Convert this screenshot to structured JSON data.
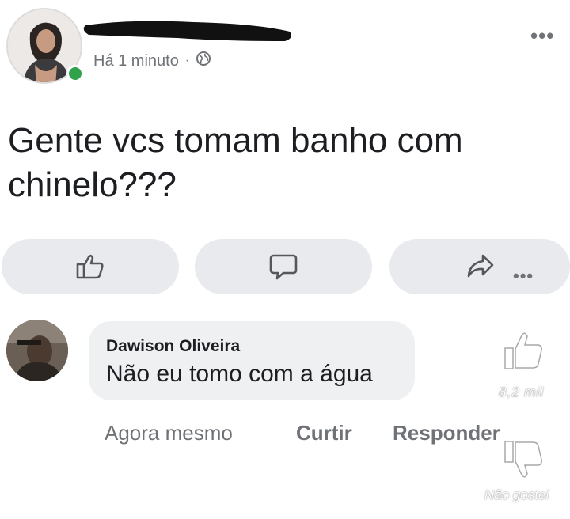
{
  "post": {
    "timestamp": "Há 1 minuto",
    "separator": "·",
    "audience_icon": "globe-icon",
    "more_icon": "more-horizontal-icon",
    "more_label": "•••",
    "text": "Gente vcs tomam banho com chinelo???"
  },
  "actions": {
    "like_icon": "thumbs-up-icon",
    "comment_icon": "comment-bubble-icon",
    "share_icon": "share-arrow-icon",
    "more_label": "•••"
  },
  "comment": {
    "author": "Dawison Oliveira",
    "text": "Não eu tomo com a água",
    "time": "Agora mesmo",
    "like_label": "Curtir",
    "reply_label": "Responder"
  },
  "overlay": {
    "like_icon": "thumbs-up-icon",
    "like_count": "8,2 mil",
    "dislike_icon": "thumbs-down-icon",
    "dislike_label": "Não gostei"
  },
  "colors": {
    "online": "#31a24c",
    "pill_bg": "#e8eaed",
    "bubble_bg": "#eef0f2",
    "meta_text": "#6f7276"
  }
}
